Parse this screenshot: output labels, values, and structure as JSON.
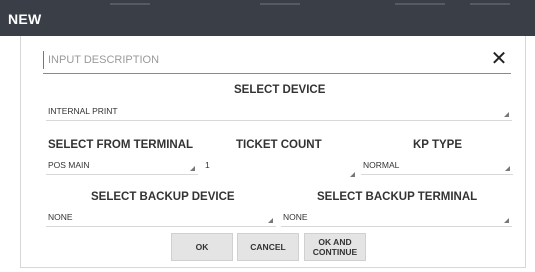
{
  "window": {
    "title": "NEW"
  },
  "description": {
    "placeholder": "INPUT DESCRIPTION",
    "value": ""
  },
  "select_device": {
    "label": "SELECT DEVICE",
    "value": "INTERNAL PRINT"
  },
  "terminal": {
    "label": "SELECT FROM TERMINAL",
    "value": "POS MAIN"
  },
  "ticket_count": {
    "label": "TICKET COUNT",
    "value": "1"
  },
  "kp_type": {
    "label": "KP TYPE",
    "value": "NORMAL"
  },
  "backup_device": {
    "label": "SELECT BACKUP DEVICE",
    "value": "NONE"
  },
  "backup_terminal": {
    "label": "SELECT BACKUP TERMINAL",
    "value": "NONE"
  },
  "buttons": {
    "ok": "OK",
    "cancel": "CANCEL",
    "ok_continue_line1": "OK AND",
    "ok_continue_line2": "CONTINUE"
  },
  "icons": {
    "close": "close-icon",
    "dropdown": "dropdown-triangle-icon"
  },
  "colors": {
    "titlebar": "#3a3f47",
    "accent_underline": "#3aa6c8",
    "button_bg": "#e4e4e4"
  }
}
